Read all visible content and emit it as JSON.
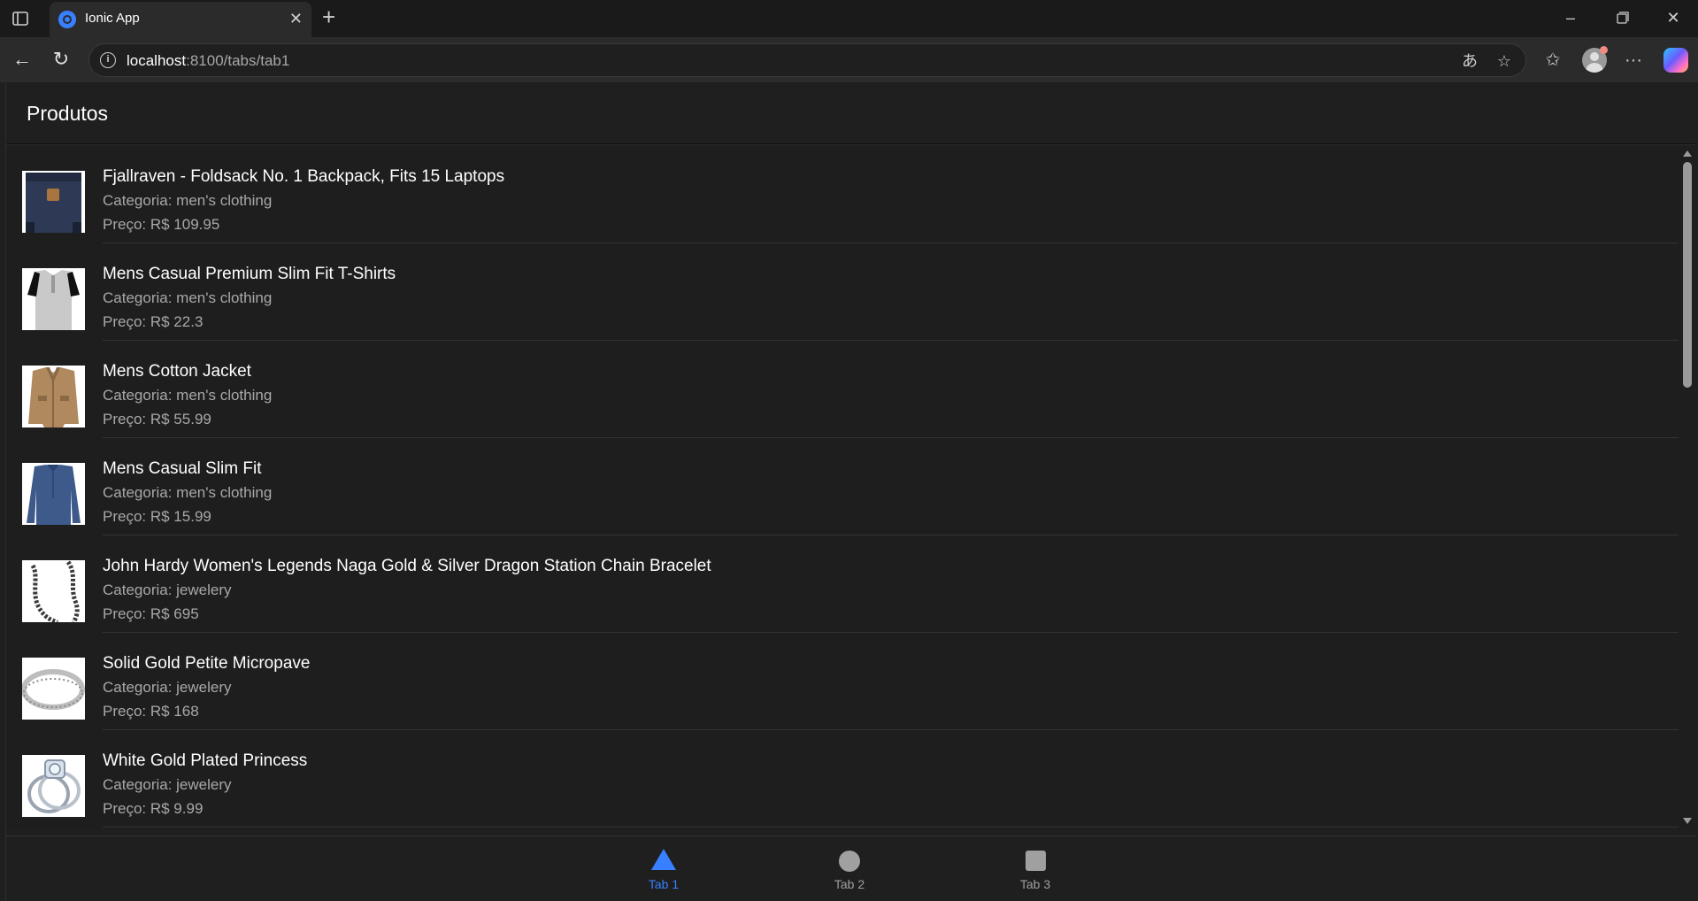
{
  "browser": {
    "tab_title": "Ionic App",
    "url_host": "localhost",
    "url_path": ":8100/tabs/tab1"
  },
  "page": {
    "title": "Produtos"
  },
  "products": [
    {
      "name": "Fjallraven - Foldsack No. 1 Backpack, Fits 15 Laptops",
      "category": "Categoria: men's clothing",
      "price": "Preço: R$ 109.95",
      "thumb": "backpack"
    },
    {
      "name": "Mens Casual Premium Slim Fit T-Shirts",
      "category": "Categoria: men's clothing",
      "price": "Preço: R$ 22.3",
      "thumb": "tshirt"
    },
    {
      "name": "Mens Cotton Jacket",
      "category": "Categoria: men's clothing",
      "price": "Preço: R$ 55.99",
      "thumb": "jacket"
    },
    {
      "name": "Mens Casual Slim Fit",
      "category": "Categoria: men's clothing",
      "price": "Preço: R$ 15.99",
      "thumb": "longsleeve"
    },
    {
      "name": "John Hardy Women's Legends Naga Gold & Silver Dragon Station Chain Bracelet",
      "category": "Categoria: jewelery",
      "price": "Preço: R$ 695",
      "thumb": "bracelet"
    },
    {
      "name": "Solid Gold Petite Micropave",
      "category": "Categoria: jewelery",
      "price": "Preço: R$ 168",
      "thumb": "ring"
    },
    {
      "name": "White Gold Plated Princess",
      "category": "Categoria: jewelery",
      "price": "Preço: R$ 9.99",
      "thumb": "ring-set"
    }
  ],
  "tabs": [
    {
      "label": "Tab 1",
      "icon": "triangle-icon",
      "active": true
    },
    {
      "label": "Tab 2",
      "icon": "ellipse-icon",
      "active": false
    },
    {
      "label": "Tab 3",
      "icon": "square-icon",
      "active": false
    }
  ],
  "colors": {
    "accent": "#3880ff",
    "background": "#1e1e1e",
    "text": "#ffffff",
    "muted": "#a8a8a8"
  }
}
